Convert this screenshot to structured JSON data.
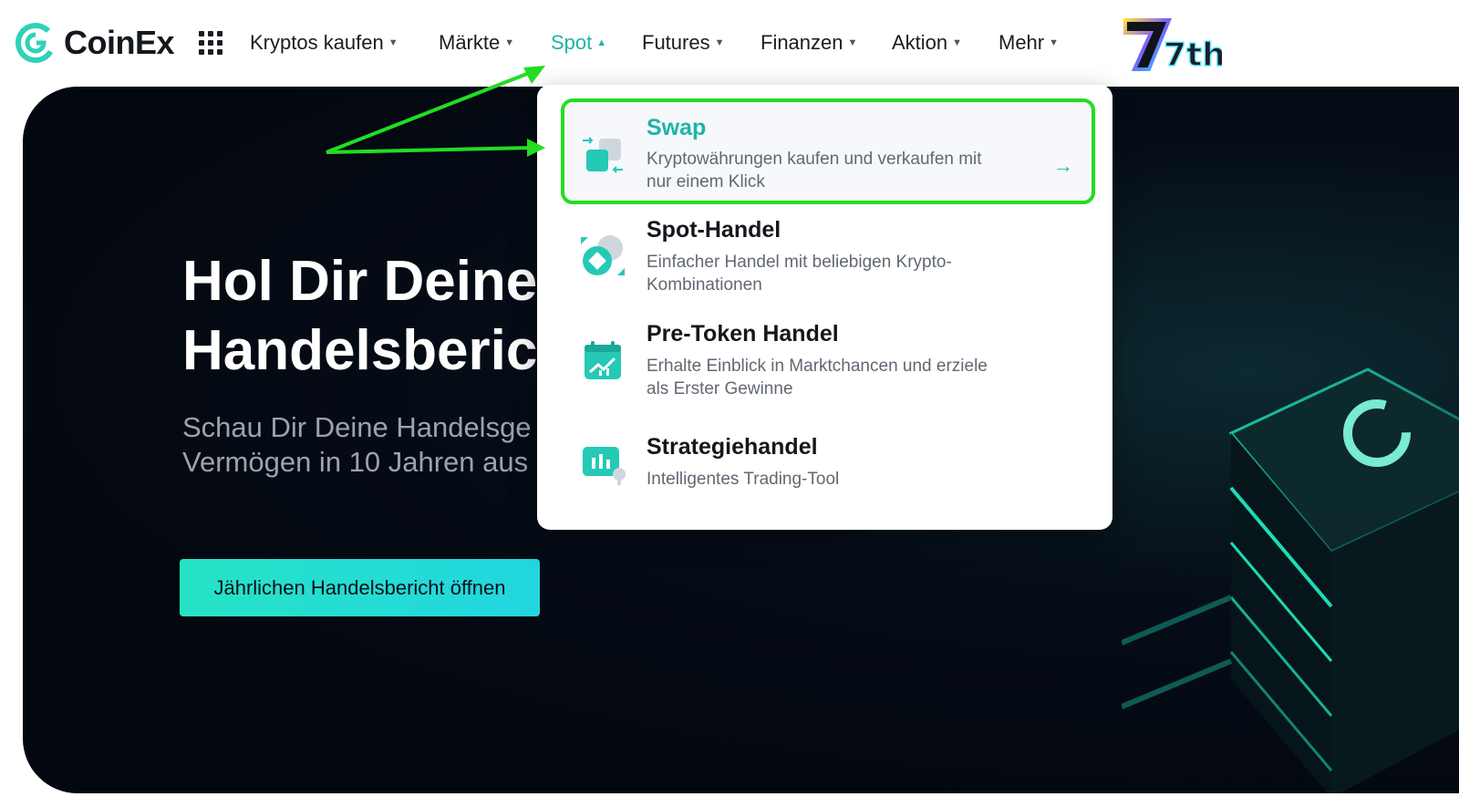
{
  "brand": {
    "name": "CoinEx"
  },
  "nav": {
    "items": [
      {
        "label": "Kryptos kaufen"
      },
      {
        "label": "Märkte"
      },
      {
        "label": "Spot"
      },
      {
        "label": "Futures"
      },
      {
        "label": "Finanzen"
      },
      {
        "label": "Aktion"
      },
      {
        "label": "Mehr"
      }
    ],
    "active": "Spot",
    "badge": "7th"
  },
  "hero": {
    "title": "Hol Dir Deine\nHandelsberic",
    "subtitle": "Schau Dir Deine Handelsge\nVermögen in 10 Jahren aus",
    "cta_label": "Jährlichen Handelsbericht öffnen"
  },
  "dropdown": {
    "items": [
      {
        "title": "Swap",
        "desc": "Kryptowährungen kaufen und verkaufen mit\nnur einem Klick",
        "icon": "swap-icon",
        "highlighted": true,
        "arrow": "→"
      },
      {
        "title": "Spot-Handel",
        "desc": "Einfacher Handel mit beliebigen Krypto-\nKombinationen",
        "icon": "spot-trade-icon"
      },
      {
        "title": "Pre-Token Handel",
        "desc": "Erhalte Einblick in Marktchancen und erziele\nals Erster Gewinne",
        "icon": "calendar-chart-icon"
      },
      {
        "title": "Strategiehandel",
        "desc": "Intelligentes Trading-Tool",
        "icon": "bar-chart-icon"
      }
    ]
  },
  "colors": {
    "accent": "#1fb3a8",
    "highlight_border": "#22dd22",
    "annotation_arrow": "#22dd22",
    "cta": "#27e3c6"
  }
}
